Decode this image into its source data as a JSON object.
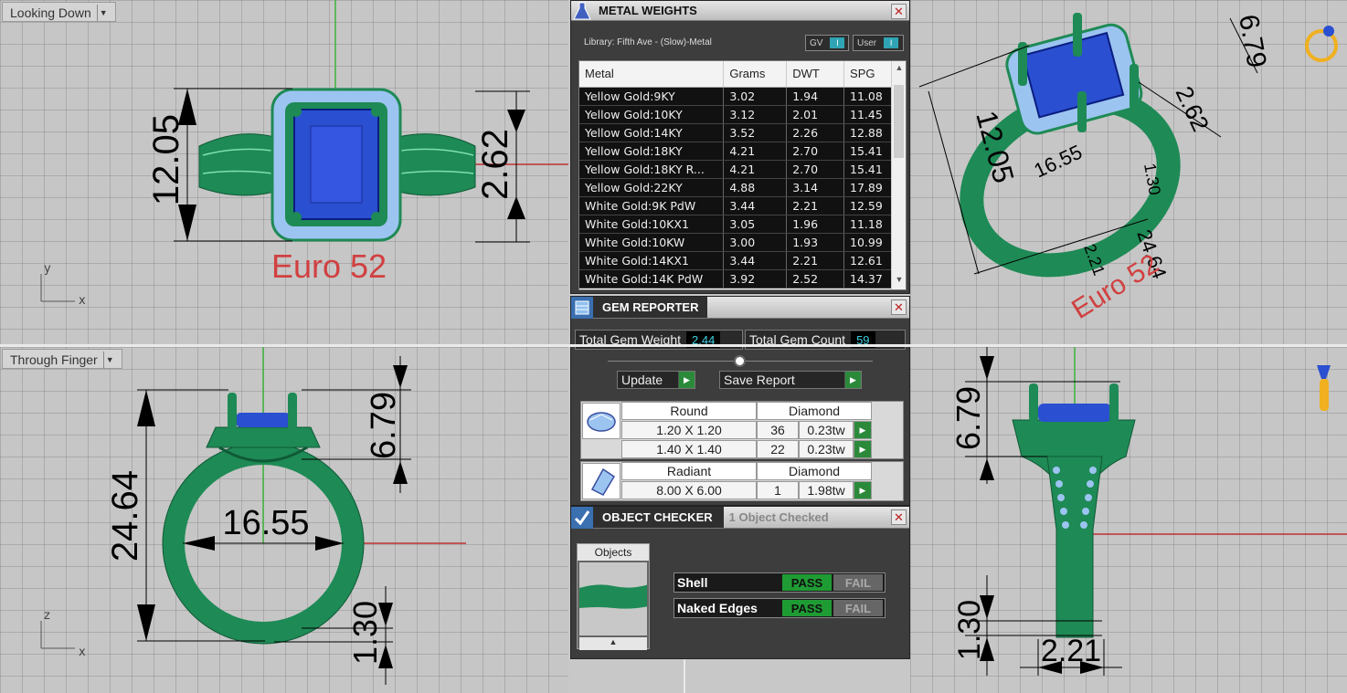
{
  "viewports": {
    "top_left": {
      "title": "Looking Down",
      "dims": [
        "12.05",
        "2.62"
      ],
      "label": "Euro 52",
      "axis_y": "y",
      "axis_x": "x"
    },
    "bottom_left": {
      "title": "Through Finger",
      "dims": [
        "24.64",
        "16.55",
        "6.79",
        "1.30"
      ],
      "axis_z": "z",
      "axis_x": "x"
    },
    "top_right": {
      "dims": [
        "12.05",
        "6.79",
        "2.62",
        "16.55",
        "1.30",
        "2.21",
        "24.64"
      ],
      "label": "Euro 52"
    },
    "bottom_right": {
      "dims": [
        "6.79",
        "1.30",
        "2.21"
      ]
    }
  },
  "metal_weights": {
    "title": "METAL WEIGHTS",
    "library": "Library: Fifth Ave - (Slow)-Metal",
    "toggle_gv": "GV",
    "toggle_user": "User",
    "columns": [
      "Metal",
      "Grams",
      "DWT",
      "SPG"
    ],
    "rows": [
      [
        "Yellow Gold:9KY",
        "3.02",
        "1.94",
        "11.08"
      ],
      [
        "Yellow Gold:10KY",
        "3.12",
        "2.01",
        "11.45"
      ],
      [
        "Yellow Gold:14KY",
        "3.52",
        "2.26",
        "12.88"
      ],
      [
        "Yellow Gold:18KY",
        "4.21",
        "2.70",
        "15.41"
      ],
      [
        "Yellow Gold:18KY R...",
        "4.21",
        "2.70",
        "15.41"
      ],
      [
        "Yellow Gold:22KY",
        "4.88",
        "3.14",
        "17.89"
      ],
      [
        "White Gold:9K PdW",
        "3.44",
        "2.21",
        "12.59"
      ],
      [
        "White Gold:10KX1",
        "3.05",
        "1.96",
        "11.18"
      ],
      [
        "White Gold:10KW",
        "3.00",
        "1.93",
        "10.99"
      ],
      [
        "White Gold:14KX1",
        "3.44",
        "2.21",
        "12.61"
      ],
      [
        "White Gold:14K PdW",
        "3.92",
        "2.52",
        "14.37"
      ]
    ]
  },
  "gem_reporter": {
    "title": "GEM REPORTER",
    "total_weight_label": "Total Gem Weight",
    "total_weight": "2.44",
    "total_count_label": "Total Gem Count",
    "total_count": "59",
    "update_label": "Update",
    "save_label": "Save Report",
    "groups": [
      {
        "shape": "Round",
        "material": "Diamond",
        "rows": [
          [
            "1.20 X 1.20",
            "36",
            "0.23tw"
          ],
          [
            "1.40 X 1.40",
            "22",
            "0.23tw"
          ]
        ]
      },
      {
        "shape": "Radiant",
        "material": "Diamond",
        "rows": [
          [
            "8.00 X 6.00",
            "1",
            "1.98tw"
          ]
        ]
      }
    ]
  },
  "object_checker": {
    "title": "OBJECT CHECKER",
    "status": "1  Object Checked",
    "objects_label": "Objects",
    "checks": [
      {
        "name": "Shell",
        "pass": "PASS",
        "fail": "FAIL"
      },
      {
        "name": "Naked Edges",
        "pass": "PASS",
        "fail": "FAIL"
      }
    ]
  },
  "colors": {
    "ring": "#1e8a55",
    "gem": "#2a4fd0",
    "small_gem": "#9cc4f0",
    "pass": "#1f9b34",
    "accent": "#3fd0e0"
  }
}
